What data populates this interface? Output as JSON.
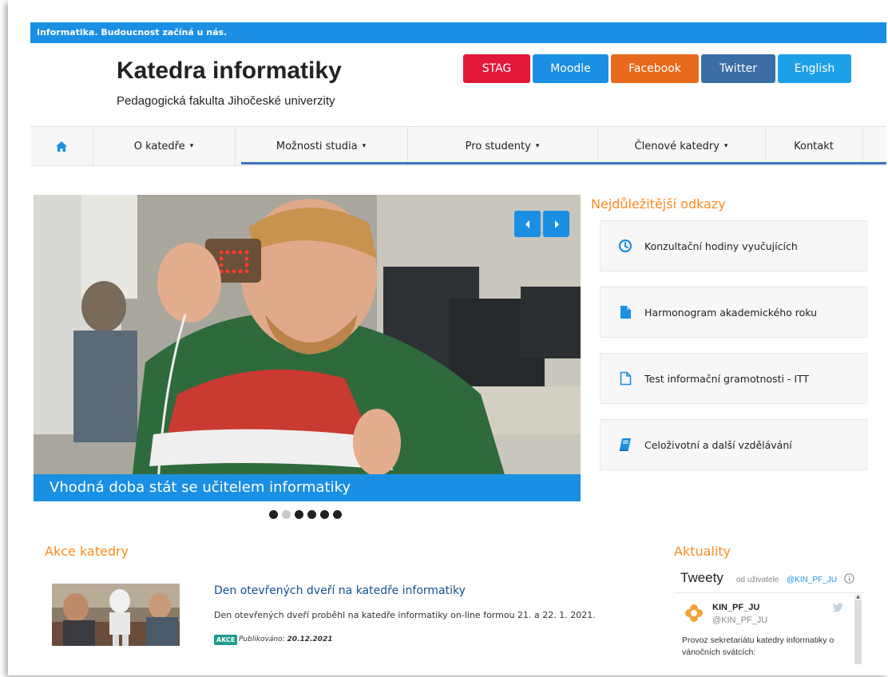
{
  "top_bar": {
    "tagline": "Informatika. Budoucnost začíná u nás."
  },
  "header": {
    "title": "Katedra informatiky",
    "subtitle": "Pedagogická fakulta Jihočeské univerzity",
    "buttons": [
      {
        "label": "STAG",
        "color": "#e2183a"
      },
      {
        "label": "Moodle",
        "color": "#1a8fe3"
      },
      {
        "label": "Facebook",
        "color": "#e86a1c"
      },
      {
        "label": "Twitter",
        "color": "#3a6ea5"
      },
      {
        "label": "English",
        "color": "#1ea0e8"
      }
    ]
  },
  "nav": {
    "home_icon": "home-icon",
    "items": [
      {
        "label": "O katedře",
        "dropdown": true
      },
      {
        "label": "Možnosti studia",
        "dropdown": true
      },
      {
        "label": "Pro studenty",
        "dropdown": true
      },
      {
        "label": "Členové katedry",
        "dropdown": true
      },
      {
        "label": "Kontakt",
        "dropdown": false
      }
    ]
  },
  "slider": {
    "caption": "Vhodná doba stát se učitelem informatiky",
    "slide_count": 6,
    "active_index": 1
  },
  "important_links": {
    "heading": "Nejdůležitější odkazy",
    "items": [
      {
        "label": "Konzultační hodiny vyučujících",
        "icon": "clock-icon"
      },
      {
        "label": "Harmonogram akademického roku",
        "icon": "file-icon"
      },
      {
        "label": "Test informační gramotnosti - ITT",
        "icon": "file-outline-icon"
      },
      {
        "label": "Celoživotní a další vzdělávání",
        "icon": "book-icon"
      }
    ]
  },
  "events": {
    "heading": "Akce katedry",
    "items": [
      {
        "title": "Den otevřených dveří na katedře informatiky",
        "description": "Den otevřených dveří proběhl na katedře informatiky on-line formou 21. a 22. 1. 2021.",
        "badge": "AKCE",
        "published_label": "Publikováno:",
        "published_date": "20.12.2021"
      }
    ]
  },
  "news": {
    "heading": "Aktuality",
    "widget_title": "Tweety",
    "by_label": "od uživatele",
    "account": "@KIN_PF_JU",
    "tweet": {
      "name": "KIN_PF_JU",
      "handle": "@KIN_PF_JU",
      "text": "Provoz sekretariátu katedry informatiky o vánočních svátcích:"
    }
  },
  "colors": {
    "accent": "#1a8fe3",
    "orange": "#ff8a1e",
    "nav_underline": "#3a73c0"
  }
}
